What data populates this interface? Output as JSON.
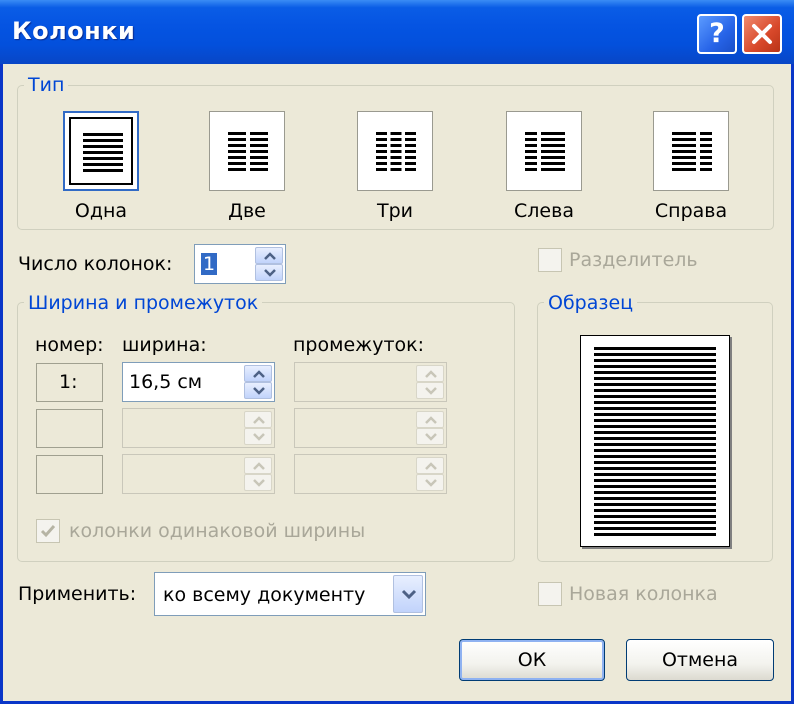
{
  "window": {
    "title": "Колонки"
  },
  "type_group": {
    "label": "Тип",
    "options": [
      {
        "label": "Одна",
        "selected": true
      },
      {
        "label": "Две",
        "selected": false
      },
      {
        "label": "Три",
        "selected": false
      },
      {
        "label": "Слева",
        "selected": false
      },
      {
        "label": "Справа",
        "selected": false
      }
    ]
  },
  "num_columns": {
    "label": "Число колонок:",
    "value": "1"
  },
  "separator": {
    "label": "Разделитель",
    "checked": false,
    "enabled": false
  },
  "width_group": {
    "label": "Ширина и промежуток",
    "headers": {
      "number": "номер:",
      "width": "ширина:",
      "spacing": "промежуток:"
    },
    "rows": [
      {
        "number": "1:",
        "width": "16,5 см",
        "spacing": ""
      },
      {
        "number": "",
        "width": "",
        "spacing": ""
      },
      {
        "number": "",
        "width": "",
        "spacing": ""
      }
    ],
    "equal_width": {
      "label": "колонки одинаковой ширины",
      "checked": true,
      "enabled": false
    }
  },
  "preview": {
    "label": "Образец"
  },
  "apply": {
    "label": "Применить:",
    "value": "ко всему документу"
  },
  "new_column": {
    "label": "Новая колонка",
    "checked": false,
    "enabled": false
  },
  "buttons": {
    "ok": "ОК",
    "cancel": "Отмена"
  },
  "icons": {
    "help": "help-icon",
    "close": "close-icon"
  },
  "colors": {
    "title_bar": "#0554e2",
    "group_label": "#0046d5",
    "dialog_bg": "#ece9d8"
  }
}
